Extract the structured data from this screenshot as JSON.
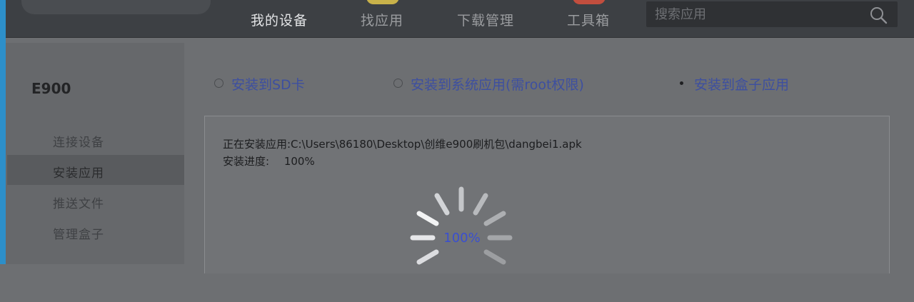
{
  "nav": {
    "items": [
      {
        "label": "我的设备",
        "active": true,
        "accent": ""
      },
      {
        "label": "找应用",
        "active": false,
        "accent": "#c9b24a"
      },
      {
        "label": "下载管理",
        "active": false,
        "accent": ""
      },
      {
        "label": "工具箱",
        "active": false,
        "accent": "#c24e3e"
      }
    ],
    "search_placeholder": "搜索应用",
    "search_icon": "search-icon"
  },
  "sidebar": {
    "device_name": "E900",
    "items": [
      {
        "label": "连接设备",
        "active": false
      },
      {
        "label": "安装应用",
        "active": true
      },
      {
        "label": "推送文件",
        "active": false
      },
      {
        "label": "管理盒子",
        "active": false
      }
    ]
  },
  "install_options": [
    {
      "label": "安装到SD卡",
      "checked": false
    },
    {
      "label": "安装到系统应用(需root权限)",
      "checked": false
    },
    {
      "label": "安装到盒子应用",
      "checked": true
    }
  ],
  "install_status": {
    "current_line": "正在安装应用:C:\\Users\\86180\\Desktop\\创维e900刷机包\\dangbei1.apk",
    "progress_label": "安装进度:",
    "progress_value": "100%",
    "progress_fraction": 1.0,
    "spinner_text": "100%"
  }
}
